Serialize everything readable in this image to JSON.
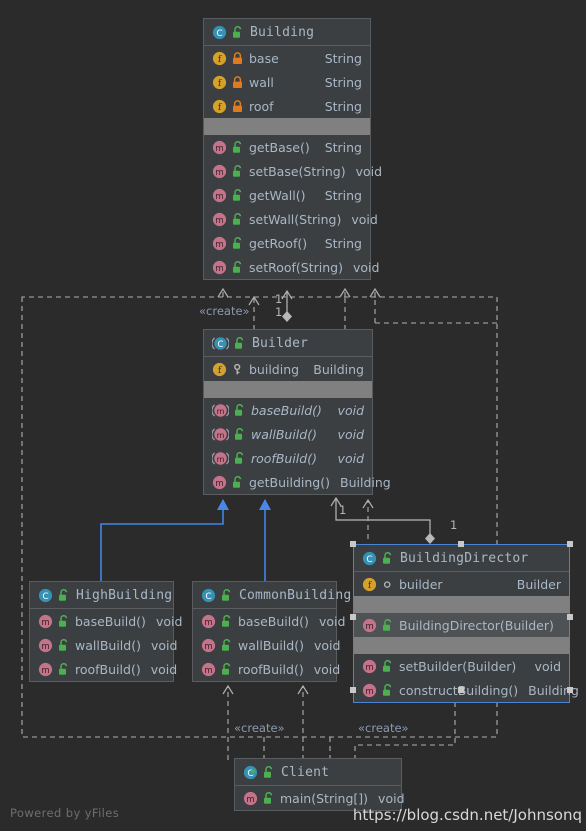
{
  "diagram": {
    "kind": "uml-class-diagram",
    "background": "#2b2b2b",
    "box_fill": "#3c3f41",
    "box_border": "#5a5d5f",
    "text_color": "#a9b7c6",
    "selection_color": "#4b84d4",
    "realization_color": "#4b84d4",
    "dependency_color": "#b0b0b0",
    "separator_color": "#808080"
  },
  "classes": {
    "building": {
      "name": "Building",
      "icon": "class-icon",
      "visibility_icon": "unlock-icon",
      "fields": [
        {
          "icon": "field-icon",
          "vis": "lock-icon",
          "name": "base",
          "type": "String"
        },
        {
          "icon": "field-icon",
          "vis": "lock-icon",
          "name": "wall",
          "type": "String"
        },
        {
          "icon": "field-icon",
          "vis": "lock-icon",
          "name": "roof",
          "type": "String"
        }
      ],
      "methods": [
        {
          "icon": "method-icon",
          "vis": "unlock-icon",
          "name": "getBase()",
          "type": "String"
        },
        {
          "icon": "method-icon",
          "vis": "unlock-icon",
          "name": "setBase(String)",
          "type": "void"
        },
        {
          "icon": "method-icon",
          "vis": "unlock-icon",
          "name": "getWall()",
          "type": "String"
        },
        {
          "icon": "method-icon",
          "vis": "unlock-icon",
          "name": "setWall(String)",
          "type": "void"
        },
        {
          "icon": "method-icon",
          "vis": "unlock-icon",
          "name": "getRoof()",
          "type": "String"
        },
        {
          "icon": "method-icon",
          "vis": "unlock-icon",
          "name": "setRoof(String)",
          "type": "void"
        }
      ]
    },
    "builder": {
      "name": "Builder",
      "icon": "abstract-class-icon",
      "visibility_icon": "unlock-icon",
      "fields": [
        {
          "icon": "field-icon",
          "vis": "key-icon",
          "name": "building",
          "type": "Building"
        }
      ],
      "methods": [
        {
          "icon": "abstract-method-icon",
          "vis": "unlock-icon",
          "name": "baseBuild()",
          "type": "void",
          "abstract": true
        },
        {
          "icon": "abstract-method-icon",
          "vis": "unlock-icon",
          "name": "wallBuild()",
          "type": "void",
          "abstract": true
        },
        {
          "icon": "abstract-method-icon",
          "vis": "unlock-icon",
          "name": "roofBuild()",
          "type": "void",
          "abstract": true
        },
        {
          "icon": "method-icon",
          "vis": "unlock-icon",
          "name": "getBuilding()",
          "type": "Building"
        }
      ]
    },
    "high_building": {
      "name": "HighBuilding",
      "icon": "class-icon",
      "visibility_icon": "unlock-icon",
      "methods": [
        {
          "icon": "method-icon",
          "vis": "unlock-icon",
          "name": "baseBuild()",
          "type": "void"
        },
        {
          "icon": "method-icon",
          "vis": "unlock-icon",
          "name": "wallBuild()",
          "type": "void"
        },
        {
          "icon": "method-icon",
          "vis": "unlock-icon",
          "name": "roofBuild()",
          "type": "void"
        }
      ]
    },
    "common_building": {
      "name": "CommonBuilding",
      "icon": "class-icon",
      "visibility_icon": "unlock-icon",
      "methods": [
        {
          "icon": "method-icon",
          "vis": "unlock-icon",
          "name": "baseBuild()",
          "type": "void"
        },
        {
          "icon": "method-icon",
          "vis": "unlock-icon",
          "name": "wallBuild()",
          "type": "void"
        },
        {
          "icon": "method-icon",
          "vis": "unlock-icon",
          "name": "roofBuild()",
          "type": "void"
        }
      ]
    },
    "building_director": {
      "name": "BuildingDirector",
      "icon": "class-icon",
      "visibility_icon": "unlock-icon",
      "selected": true,
      "fields": [
        {
          "icon": "field-icon",
          "vis": "package-icon",
          "name": "builder",
          "type": "Builder"
        }
      ],
      "constructors": [
        {
          "icon": "method-icon",
          "vis": "unlock-icon",
          "name": "BuildingDirector(Builder)",
          "type": ""
        }
      ],
      "methods": [
        {
          "icon": "method-icon",
          "vis": "unlock-icon",
          "name": "setBuilder(Builder)",
          "type": "void"
        },
        {
          "icon": "method-icon",
          "vis": "unlock-icon",
          "name": "constructBuilding()",
          "type": "Building"
        }
      ]
    },
    "client": {
      "name": "Client",
      "icon": "runnable-class-icon",
      "visibility_icon": "unlock-icon",
      "methods": [
        {
          "icon": "method-icon",
          "vis": "unlock-icon",
          "name": "main(String[])",
          "type": "void"
        }
      ]
    }
  },
  "edge_labels": {
    "create_top": "«create»",
    "create_bottom_left": "«create»",
    "create_bottom_right": "«create»"
  },
  "multiplicities": {
    "builder_building_src": "1",
    "builder_building_tgt": "1",
    "director_builder_src": "1",
    "director_builder_tgt": "1"
  },
  "watermarks": {
    "left": "Powered by yFiles",
    "right": "https://blog.csdn.net/Johnsonq"
  }
}
